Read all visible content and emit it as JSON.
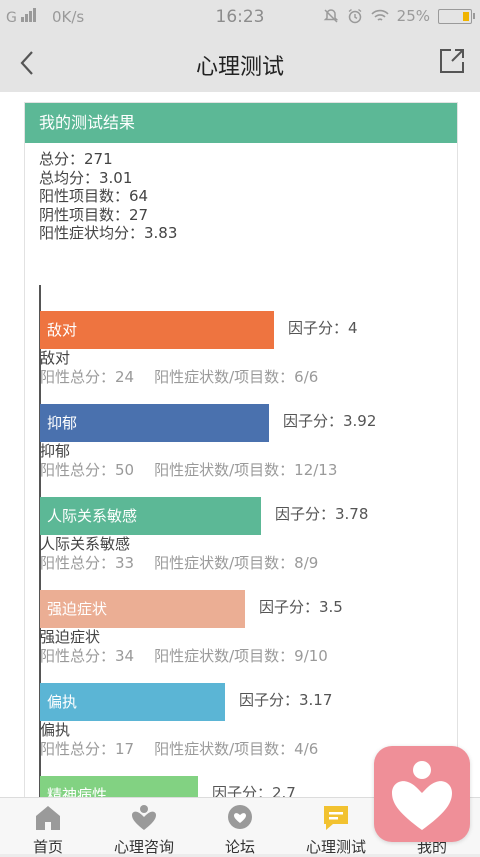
{
  "status_bar": {
    "network": "G",
    "speed": "0K/s",
    "time": "16:23",
    "battery": "25%",
    "battery_level": 0.25
  },
  "nav": {
    "title": "心理测试",
    "back_icon": "chevron-left-icon",
    "share_icon": "share-external-icon"
  },
  "result": {
    "header": "我的测试结果",
    "summary": {
      "total": "总分：271",
      "avg": "总均分：3.01",
      "positive_count": "阳性项目数：64",
      "negative_count": "阴性项目数：27",
      "positive_avg": "阳性症状均分：3.83"
    }
  },
  "chart_data": {
    "type": "bar",
    "categories": [
      "敌对",
      "抑郁",
      "人际关系敏感",
      "强迫症状",
      "偏执",
      "精神病性"
    ],
    "values": [
      4,
      3.92,
      3.78,
      3.5,
      3.17,
      2.7
    ],
    "colors": [
      "#ee7440",
      "#4a71ae",
      "#5cb896",
      "#ebae94",
      "#5bb5d5",
      "#82d282"
    ]
  },
  "factors": [
    {
      "label": "敌对",
      "score_text": "因子分：4",
      "name": "敌对",
      "pos_total": "阳性总分：24",
      "ratio": "阳性症状数/项目数：6/6"
    },
    {
      "label": "抑郁",
      "score_text": "因子分：3.92",
      "name": "抑郁",
      "pos_total": "阳性总分：50",
      "ratio": "阳性症状数/项目数：12/13"
    },
    {
      "label": "人际关系敏感",
      "score_text": "因子分：3.78",
      "name": "人际关系敏感",
      "pos_total": "阳性总分：33",
      "ratio": "阳性症状数/项目数：8/9"
    },
    {
      "label": "强迫症状",
      "score_text": "因子分：3.5",
      "name": "强迫症状",
      "pos_total": "阳性总分：34",
      "ratio": "阳性症状数/项目数：9/10"
    },
    {
      "label": "偏执",
      "score_text": "因子分：3.17",
      "name": "偏执",
      "pos_total": "阳性总分：17",
      "ratio": "阳性症状数/项目数：4/6"
    },
    {
      "label": "精神病性",
      "score_text": "因子分：2.7",
      "name": "",
      "pos_total": "",
      "ratio": ""
    }
  ],
  "tabs": [
    {
      "label": "首页",
      "icon": "home-icon"
    },
    {
      "label": "心理咨询",
      "icon": "heart-person-icon"
    },
    {
      "label": "论坛",
      "icon": "chat-bubble-icon"
    },
    {
      "label": "心理测试",
      "icon": "message-lines-icon",
      "active": true
    },
    {
      "label": "我的",
      "icon": "profile-icon"
    }
  ],
  "colors": {
    "accent": "#5cb896",
    "active_tab": "#f2c230",
    "tab_icon": "#9a9a9a",
    "fab": "#ef8f98"
  }
}
